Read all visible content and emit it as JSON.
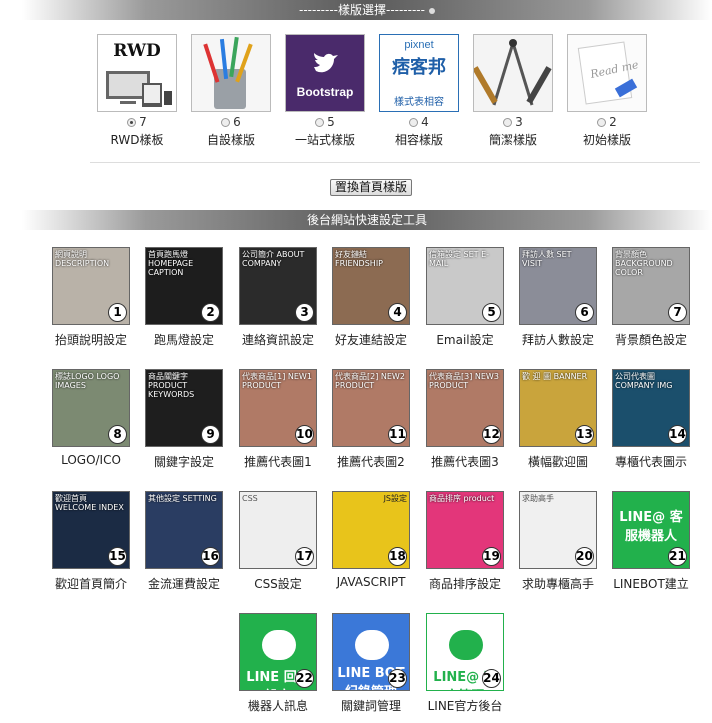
{
  "template_section": {
    "title": "---------樣版選擇---------"
  },
  "templates": [
    {
      "id": "rwd",
      "count": "7",
      "label": "RWD樣板",
      "selected": true,
      "thumb_text": "RWD"
    },
    {
      "id": "custom",
      "count": "6",
      "label": "自設樣版",
      "selected": false
    },
    {
      "id": "bootstrap",
      "count": "5",
      "label": "一站式樣版",
      "selected": false,
      "thumb_text": "Bootstrap"
    },
    {
      "id": "compat",
      "count": "4",
      "label": "相容樣版",
      "selected": false,
      "thumb_text_1": "pixnet",
      "thumb_text_2": "痞客邦",
      "thumb_text_3": "樣式表相容"
    },
    {
      "id": "simple",
      "count": "3",
      "label": "簡潔樣版",
      "selected": false
    },
    {
      "id": "initial",
      "count": "2",
      "label": "初始樣版",
      "selected": false,
      "thumb_text": "Read me"
    }
  ],
  "apply_button": "置換首頁樣版",
  "tools_section": {
    "title": "後台網站快速設定工具"
  },
  "tools": [
    {
      "num": "1",
      "label": "抬頭說明設定",
      "caption": "網頁說明 DESCRIPTION",
      "bg": "#b9b2a8"
    },
    {
      "num": "2",
      "label": "跑馬燈設定",
      "caption": "首頁跑馬燈 HOMEPAGE CAPTION",
      "bg": "#1d1d1d"
    },
    {
      "num": "3",
      "label": "連絡資訊設定",
      "caption": "公司簡介 ABOUT COMPANY",
      "bg": "#2b2b2b"
    },
    {
      "num": "4",
      "label": "好友連結設定",
      "caption": "好友鏈結 FRIENDSHIP",
      "bg": "#8c6b52"
    },
    {
      "num": "5",
      "label": "Email設定",
      "caption": "信箱設定 SET E-MAIL",
      "bg": "#c9c9c9"
    },
    {
      "num": "6",
      "label": "拜訪人數設定",
      "caption": "拜訪人數 SET VISIT",
      "bg": "#8b8d98"
    },
    {
      "num": "7",
      "label": "背景顏色設定",
      "caption": "背景顏色 BACKGROUND COLOR",
      "bg": "#a7a7a7"
    },
    {
      "num": "8",
      "label": "LOGO/ICO",
      "caption": "標誌LOGO LOGO IMAGES",
      "bg": "#7c8a72"
    },
    {
      "num": "9",
      "label": "關鍵字設定",
      "caption": "商品關鍵字 PRODUCT KEYWORDS",
      "bg": "#1e1e1e"
    },
    {
      "num": "10",
      "label": "推薦代表圖1",
      "caption": "代表商品[1] NEW1 PRODUCT",
      "bg": "#b07a66"
    },
    {
      "num": "11",
      "label": "推薦代表圖2",
      "caption": "代表商品[2] NEW2 PRODUCT",
      "bg": "#b07a66"
    },
    {
      "num": "12",
      "label": "推薦代表圖3",
      "caption": "代表商品[3] NEW3 PRODUCT",
      "bg": "#b07a66"
    },
    {
      "num": "13",
      "label": "橫幅歡迎圖",
      "caption": "歡 迎 圖 BANNER",
      "bg": "#c9a43c"
    },
    {
      "num": "14",
      "label": "專櫃代表圖示",
      "caption": "公司代表圖 COMPANY IMG",
      "bg": "#1b4f6c"
    },
    {
      "num": "15",
      "label": "歡迎首頁簡介",
      "caption": "歡迎首頁 WELCOME INDEX",
      "bg": "#1b2b44"
    },
    {
      "num": "16",
      "label": "金流運費設定",
      "caption": "其他設定 SETTING",
      "bg": "#2a3d62"
    },
    {
      "num": "17",
      "label": "CSS設定",
      "caption": "CSS",
      "bg": "#eeeeee"
    },
    {
      "num": "18",
      "label": "JAVASCRIPT",
      "caption": "JS設定",
      "bg": "#e8c41b"
    },
    {
      "num": "19",
      "label": "商品排序設定",
      "caption": "商品排序 product",
      "bg": "#e3367a"
    },
    {
      "num": "20",
      "label": "求助專櫃高手",
      "caption": "求助高手",
      "bg": "#f0f0f0"
    },
    {
      "num": "21",
      "label": "LINEBOT建立",
      "caption": "LINE@ 客服機器人",
      "bg": "#22b14c"
    },
    {
      "num": "22",
      "label": "機器人訊息",
      "caption": "LINE 回應設定",
      "bg": "#22b14c"
    },
    {
      "num": "23",
      "label": "關鍵詞管理",
      "caption": "LINE BOT 紀錄管理",
      "bg": "#3b78d8"
    },
    {
      "num": "24",
      "label": "LINE官方後台",
      "caption": "LINE@ 官方管理",
      "bg": "#ffffff"
    }
  ]
}
